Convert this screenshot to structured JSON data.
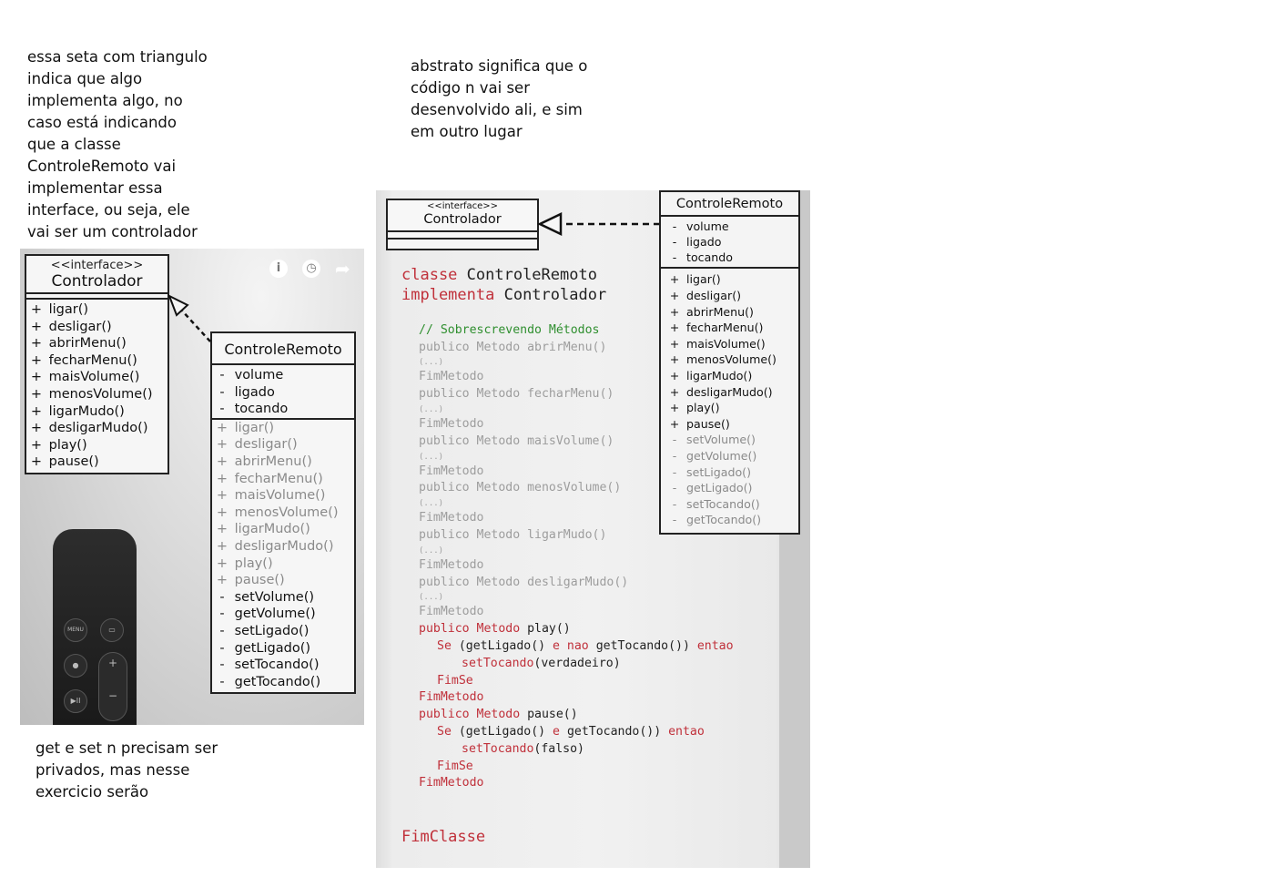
{
  "notes": {
    "left_top": [
      "essa seta com triangulo",
      "indica que algo",
      "implementa algo, no",
      "caso está indicando",
      "que a classe",
      "ControleRemoto vai",
      "implementar essa",
      "interface, ou seja, ele",
      "vai ser um controlador"
    ],
    "middle_top": [
      "abstrato significa que o",
      "código n vai ser",
      "desenvolvido ali, e sim",
      "em outro lugar"
    ],
    "left_bottom": [
      "get e set n precisam ser",
      "privados, mas nesse",
      "exercicio serão"
    ]
  },
  "shot1": {
    "interface": {
      "stereotype": "<<interface>>",
      "name": "Controlador",
      "methods": [
        {
          "vis": "+",
          "name": "ligar()"
        },
        {
          "vis": "+",
          "name": "desligar()"
        },
        {
          "vis": "+",
          "name": "abrirMenu()"
        },
        {
          "vis": "+",
          "name": "fecharMenu()"
        },
        {
          "vis": "+",
          "name": "maisVolume()"
        },
        {
          "vis": "+",
          "name": "menosVolume()"
        },
        {
          "vis": "+",
          "name": "ligarMudo()"
        },
        {
          "vis": "+",
          "name": "desligarMudo()"
        },
        {
          "vis": "+",
          "name": "play()"
        },
        {
          "vis": "+",
          "name": "pause()"
        }
      ]
    },
    "class": {
      "name": "ControleRemoto",
      "attributes": [
        {
          "vis": "-",
          "name": "volume"
        },
        {
          "vis": "-",
          "name": "ligado"
        },
        {
          "vis": "-",
          "name": "tocando"
        }
      ],
      "methods": [
        {
          "vis": "+",
          "name": "ligar()",
          "muted": true
        },
        {
          "vis": "+",
          "name": "desligar()",
          "muted": true
        },
        {
          "vis": "+",
          "name": "abrirMenu()",
          "muted": true
        },
        {
          "vis": "+",
          "name": "fecharMenu()",
          "muted": true
        },
        {
          "vis": "+",
          "name": "maisVolume()",
          "muted": true
        },
        {
          "vis": "+",
          "name": "menosVolume()",
          "muted": true
        },
        {
          "vis": "+",
          "name": "ligarMudo()",
          "muted": true
        },
        {
          "vis": "+",
          "name": "desligarMudo()",
          "muted": true
        },
        {
          "vis": "+",
          "name": "play()",
          "muted": true
        },
        {
          "vis": "+",
          "name": "pause()",
          "muted": true
        },
        {
          "vis": "-",
          "name": "setVolume()"
        },
        {
          "vis": "-",
          "name": "getVolume()"
        },
        {
          "vis": "-",
          "name": "setLigado()"
        },
        {
          "vis": "-",
          "name": "getLigado()"
        },
        {
          "vis": "-",
          "name": "setTocando()"
        },
        {
          "vis": "-",
          "name": "getTocando()"
        }
      ]
    },
    "icons": [
      "info-icon",
      "clock-icon",
      "share-icon"
    ],
    "remote": {
      "menu_label": "MENU",
      "play_label": "▶II",
      "plus_label": "+",
      "minus_label": "−"
    }
  },
  "shot2": {
    "interface": {
      "stereotype": "<<interface>>",
      "name": "Controlador"
    },
    "class": {
      "name": "ControleRemoto",
      "attributes": [
        {
          "vis": "-",
          "name": "volume"
        },
        {
          "vis": "-",
          "name": "ligado"
        },
        {
          "vis": "-",
          "name": "tocando"
        }
      ],
      "methods": [
        {
          "vis": "+",
          "name": "ligar()"
        },
        {
          "vis": "+",
          "name": "desligar()"
        },
        {
          "vis": "+",
          "name": "abrirMenu()"
        },
        {
          "vis": "+",
          "name": "fecharMenu()"
        },
        {
          "vis": "+",
          "name": "maisVolume()"
        },
        {
          "vis": "+",
          "name": "menosVolume()"
        },
        {
          "vis": "+",
          "name": "ligarMudo()"
        },
        {
          "vis": "+",
          "name": "desligarMudo()"
        },
        {
          "vis": "+",
          "name": "play()"
        },
        {
          "vis": "+",
          "name": "pause()"
        },
        {
          "vis": "-",
          "name": "setVolume()",
          "muted": true
        },
        {
          "vis": "-",
          "name": "getVolume()",
          "muted": true
        },
        {
          "vis": "-",
          "name": "setLigado()",
          "muted": true
        },
        {
          "vis": "-",
          "name": "getLigado()",
          "muted": true
        },
        {
          "vis": "-",
          "name": "setTocando()",
          "muted": true
        },
        {
          "vis": "-",
          "name": "getTocando()",
          "muted": true
        }
      ]
    },
    "code": [
      {
        "indent": 0,
        "big": true,
        "parts": [
          [
            "kw",
            "classe "
          ],
          [
            "tx",
            "ControleRemoto"
          ]
        ]
      },
      {
        "indent": 0,
        "big": true,
        "parts": [
          [
            "kw",
            "implementa "
          ],
          [
            "tx",
            "Controlador"
          ]
        ]
      },
      {
        "indent": 0,
        "parts": []
      },
      {
        "indent": 1,
        "parts": [
          [
            "cm",
            "// Sobrescrevendo Métodos"
          ]
        ]
      },
      {
        "indent": 1,
        "parts": [
          [
            "gr",
            "publico Metodo abrirMenu()"
          ]
        ]
      },
      {
        "indent": 1,
        "small": true,
        "parts": [
          [
            "gr",
            "(...)"
          ]
        ]
      },
      {
        "indent": 1,
        "parts": [
          [
            "gr",
            "FimMetodo"
          ]
        ]
      },
      {
        "indent": 1,
        "parts": [
          [
            "gr",
            "publico Metodo fecharMenu()"
          ]
        ]
      },
      {
        "indent": 1,
        "small": true,
        "parts": [
          [
            "gr",
            "(...)"
          ]
        ]
      },
      {
        "indent": 1,
        "parts": [
          [
            "gr",
            "FimMetodo"
          ]
        ]
      },
      {
        "indent": 1,
        "parts": [
          [
            "gr",
            "publico Metodo maisVolume()"
          ]
        ]
      },
      {
        "indent": 1,
        "small": true,
        "parts": [
          [
            "gr",
            "(...)"
          ]
        ]
      },
      {
        "indent": 1,
        "parts": [
          [
            "gr",
            "FimMetodo"
          ]
        ]
      },
      {
        "indent": 1,
        "parts": [
          [
            "gr",
            "publico Metodo menosVolume()"
          ]
        ]
      },
      {
        "indent": 1,
        "small": true,
        "parts": [
          [
            "gr",
            "(...)"
          ]
        ]
      },
      {
        "indent": 1,
        "parts": [
          [
            "gr",
            "FimMetodo"
          ]
        ]
      },
      {
        "indent": 1,
        "parts": [
          [
            "gr",
            "publico Metodo ligarMudo()"
          ]
        ]
      },
      {
        "indent": 1,
        "small": true,
        "parts": [
          [
            "gr",
            "(...)"
          ]
        ]
      },
      {
        "indent": 1,
        "parts": [
          [
            "gr",
            "FimMetodo"
          ]
        ]
      },
      {
        "indent": 1,
        "parts": [
          [
            "gr",
            "publico Metodo desligarMudo()"
          ]
        ]
      },
      {
        "indent": 1,
        "small": true,
        "parts": [
          [
            "gr",
            "(...)"
          ]
        ]
      },
      {
        "indent": 1,
        "parts": [
          [
            "gr",
            "FimMetodo"
          ]
        ]
      },
      {
        "indent": 1,
        "parts": [
          [
            "kw",
            "publico Metodo "
          ],
          [
            "tx",
            "play()"
          ]
        ]
      },
      {
        "indent": 2,
        "parts": [
          [
            "kw",
            "Se "
          ],
          [
            "tx",
            "(getLigado() "
          ],
          [
            "kw",
            "e nao "
          ],
          [
            "tx",
            "getTocando()) "
          ],
          [
            "kw",
            "entao"
          ]
        ]
      },
      {
        "indent": 3,
        "parts": [
          [
            "kw",
            "setTocando"
          ],
          [
            "tx",
            "(verdadeiro)"
          ]
        ]
      },
      {
        "indent": 2,
        "parts": [
          [
            "kw",
            "FimSe"
          ]
        ]
      },
      {
        "indent": 1,
        "parts": [
          [
            "kw",
            "FimMetodo"
          ]
        ]
      },
      {
        "indent": 1,
        "parts": [
          [
            "kw",
            "publico Metodo "
          ],
          [
            "tx",
            "pause()"
          ]
        ]
      },
      {
        "indent": 2,
        "parts": [
          [
            "kw",
            "Se "
          ],
          [
            "tx",
            "(getLigado() "
          ],
          [
            "kw",
            "e "
          ],
          [
            "tx",
            "getTocando()) "
          ],
          [
            "kw",
            "entao"
          ]
        ]
      },
      {
        "indent": 3,
        "parts": [
          [
            "kw",
            "setTocando"
          ],
          [
            "tx",
            "(falso)"
          ]
        ]
      },
      {
        "indent": 2,
        "parts": [
          [
            "kw",
            "FimSe"
          ]
        ]
      },
      {
        "indent": 1,
        "parts": [
          [
            "kw",
            "FimMetodo"
          ]
        ]
      },
      {
        "indent": 0,
        "parts": []
      },
      {
        "indent": 0,
        "parts": []
      },
      {
        "indent": 0,
        "big": true,
        "parts": [
          [
            "kw",
            "FimClasse"
          ]
        ]
      }
    ]
  }
}
